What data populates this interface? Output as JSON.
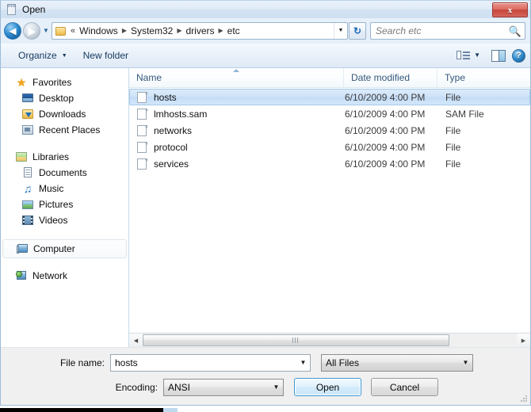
{
  "window": {
    "title": "Open",
    "title_icon": "notepad-icon",
    "close_label": "x"
  },
  "navigation": {
    "back_glyph": "◀",
    "forward_glyph": "▶",
    "history_caret": "▼",
    "address_caret": "▼",
    "refresh_glyph": "↻",
    "path_prefix": "«",
    "breadcrumbs": [
      "Windows",
      "System32",
      "drivers",
      "etc"
    ],
    "separator": "▶"
  },
  "search": {
    "placeholder": "Search etc",
    "icon": "search-icon"
  },
  "toolbar": {
    "organize_label": "Organize",
    "organize_caret": "▼",
    "new_folder_label": "New folder",
    "view_caret": "▼",
    "help_label": "?"
  },
  "sidebar": {
    "groups": [
      {
        "header": {
          "label": "Favorites",
          "icon": "star-icon"
        },
        "items": [
          {
            "label": "Desktop",
            "icon": "desktop-icon"
          },
          {
            "label": "Downloads",
            "icon": "downloads-folder-icon"
          },
          {
            "label": "Recent Places",
            "icon": "recent-places-icon"
          }
        ]
      },
      {
        "header": {
          "label": "Libraries",
          "icon": "libraries-icon"
        },
        "items": [
          {
            "label": "Documents",
            "icon": "documents-icon"
          },
          {
            "label": "Music",
            "icon": "music-note-icon"
          },
          {
            "label": "Pictures",
            "icon": "pictures-icon"
          },
          {
            "label": "Videos",
            "icon": "videos-icon"
          }
        ]
      }
    ],
    "computer": {
      "label": "Computer",
      "icon": "computer-icon",
      "highlighted": true
    },
    "network": {
      "label": "Network",
      "icon": "network-icon"
    }
  },
  "filelist": {
    "columns": [
      "Name",
      "Date modified",
      "Type"
    ],
    "sort_column": "Name",
    "sort_direction": "ascending",
    "rows": [
      {
        "name": "hosts",
        "date": "6/10/2009 4:00 PM",
        "type": "File",
        "selected": true
      },
      {
        "name": "lmhosts.sam",
        "date": "6/10/2009 4:00 PM",
        "type": "SAM File",
        "selected": false
      },
      {
        "name": "networks",
        "date": "6/10/2009 4:00 PM",
        "type": "File",
        "selected": false
      },
      {
        "name": "protocol",
        "date": "6/10/2009 4:00 PM",
        "type": "File",
        "selected": false
      },
      {
        "name": "services",
        "date": "6/10/2009 4:00 PM",
        "type": "File",
        "selected": false
      }
    ]
  },
  "scrollbar": {
    "left_arrow": "◀",
    "right_arrow": "▶"
  },
  "footer": {
    "filename_label": "File name:",
    "filename_value": "hosts",
    "filter_value": "All Files",
    "encoding_label": "Encoding:",
    "encoding_value": "ANSI",
    "open_label": "Open",
    "cancel_label": "Cancel",
    "caret": "▼"
  },
  "colors": {
    "selection_blue": "#cfe3f8",
    "default_button_border": "#3d9ad4",
    "close_button_red": "#c5463c",
    "folder_yellow": "#f6d071"
  }
}
